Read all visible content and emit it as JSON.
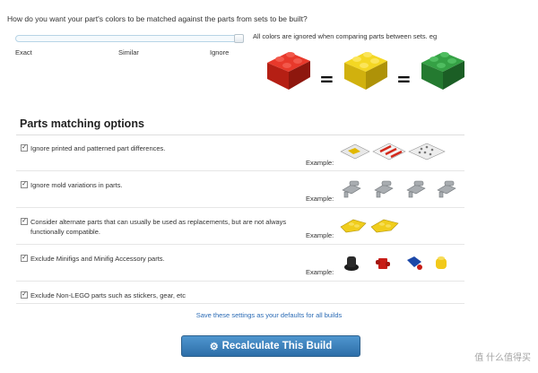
{
  "question": "How do you want your part's colors to be matched against the parts from sets to be built?",
  "slider": {
    "labels": [
      "Exact",
      "Similar",
      "Ignore"
    ],
    "selected": "Ignore",
    "value_fraction": 1.0
  },
  "ignore_note": "All colors are ignored when comparing parts between sets. eg",
  "equals_sign": "=",
  "brick_colors": [
    "#d4281c",
    "#e8c919",
    "#2b8f3a"
  ],
  "section_title": "Parts matching options",
  "example_label": "Example:",
  "options": [
    {
      "label": "Ignore printed and patterned part differences.",
      "checked": true
    },
    {
      "label": "Ignore mold variations in parts.",
      "checked": true
    },
    {
      "label": "Consider alternate parts that can usually be used as replacements, but are not always functionally compatible.",
      "checked": true
    },
    {
      "label": "Exclude Minifigs and Minifig Accessory parts.",
      "checked": true
    },
    {
      "label": "Exclude Non-LEGO parts such as stickers, gear, etc",
      "checked": true
    }
  ],
  "check_mark": "✓",
  "save_link": "Save these settings as your defaults for all builds",
  "recalc_button": "Recalculate This Build",
  "gear_glyph": "⚙",
  "watermark": "值 什么值得买"
}
